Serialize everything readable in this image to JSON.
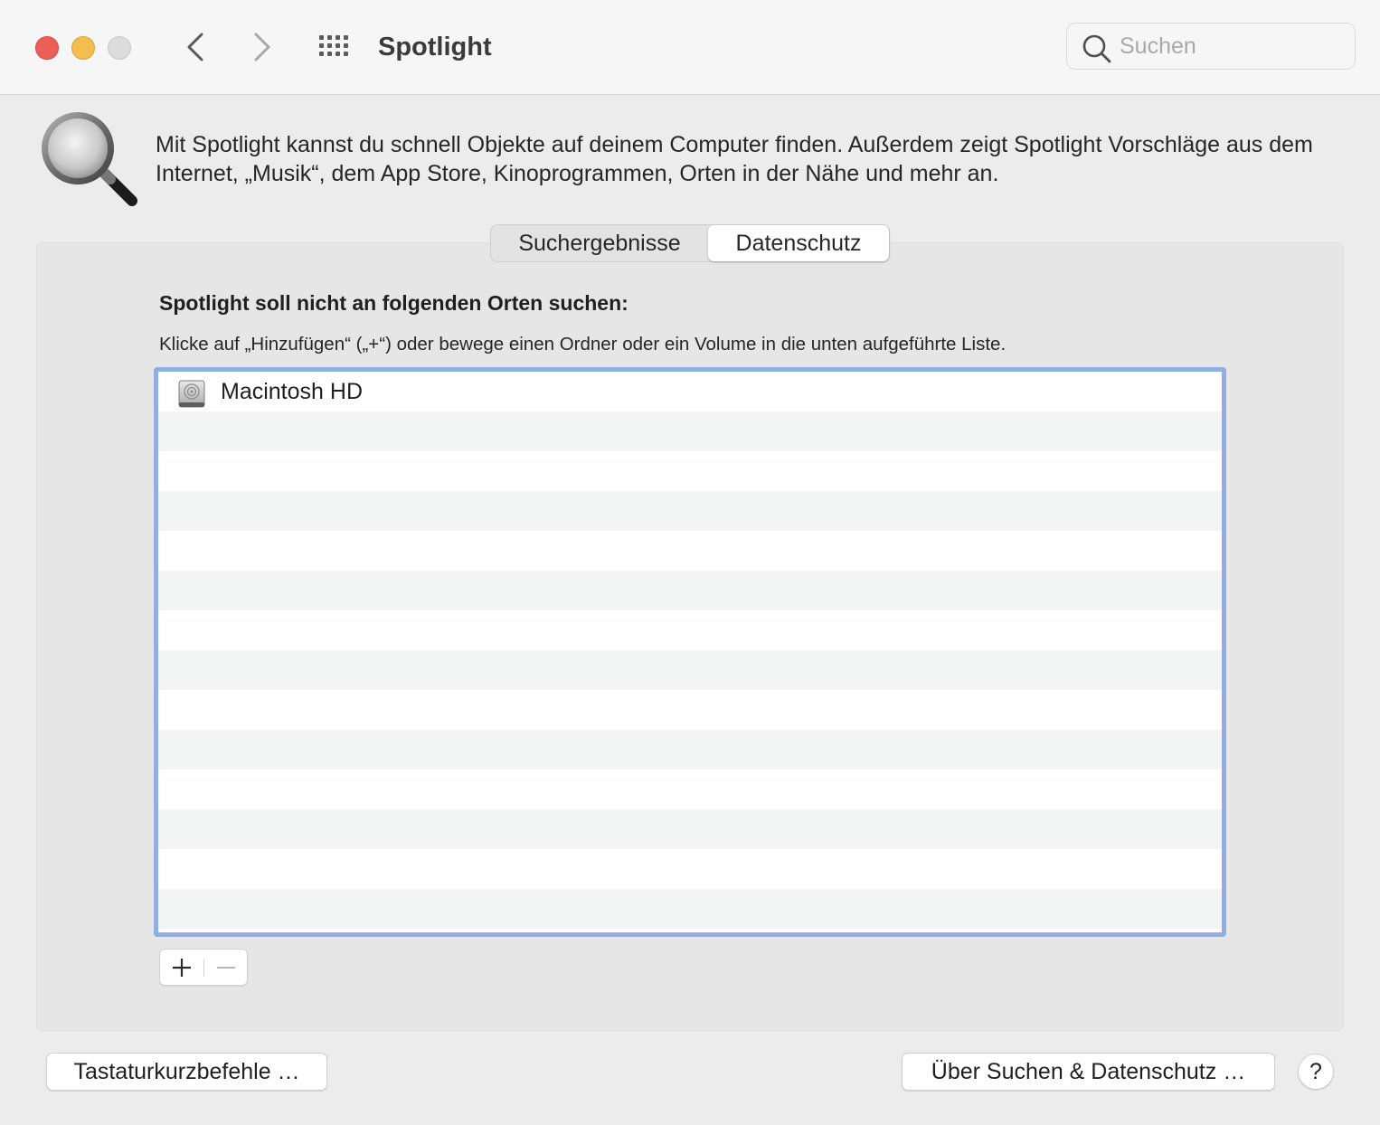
{
  "window": {
    "title": "Spotlight",
    "search_placeholder": "Suchen"
  },
  "header": {
    "description": "Mit Spotlight kannst du schnell Objekte auf deinem Computer finden. Außerdem zeigt Spotlight Vorschläge aus dem Internet, „Musik“, dem App Store, Kinoprogrammen, Orten in der Nähe und mehr an."
  },
  "tabs": [
    {
      "label": "Suchergebnisse",
      "selected": false
    },
    {
      "label": "Datenschutz",
      "selected": true
    }
  ],
  "privacy": {
    "title": "Spotlight soll nicht an folgenden Orten suchen:",
    "hint": "Klicke auf „Hinzufügen“ („+“) oder bewege einen Ordner oder ein Volume in die unten aufgeführte Liste.",
    "items": [
      {
        "label": "Macintosh HD",
        "icon": "hard-disk-icon"
      }
    ]
  },
  "buttons": {
    "shortcuts": "Tastaturkurzbefehle …",
    "about": "Über Suchen & Datenschutz …",
    "help": "?"
  },
  "colors": {
    "close": "#ec5f57",
    "minimize": "#f4bd4f",
    "zoom_disabled": "#dcdcdc",
    "list_focus_ring": "#8faee7"
  }
}
